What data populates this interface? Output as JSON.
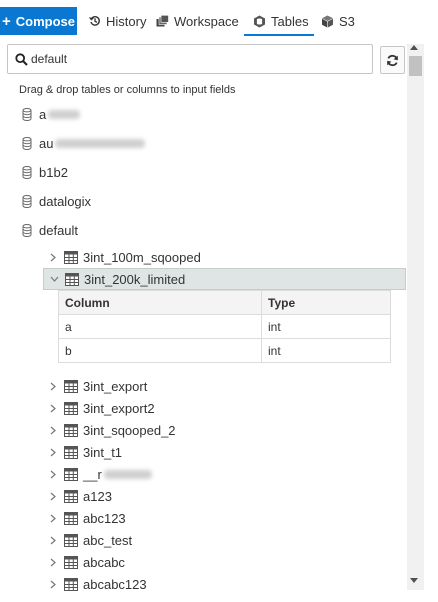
{
  "tabs": {
    "compose_label": "Compose",
    "history_label": "History",
    "workspace_label": "Workspace",
    "tables_label": "Tables",
    "s3_label": "S3",
    "active": "Tables"
  },
  "search": {
    "value": "default",
    "placeholder": "Search"
  },
  "hint": "Drag & drop tables or columns to input fields",
  "databases": [
    {
      "label": "a",
      "blurred": true
    },
    {
      "label": "au",
      "blurred": true
    },
    {
      "label": "b1b2",
      "blurred": false
    },
    {
      "label": "datalogix",
      "blurred": false
    },
    {
      "label": "default",
      "blurred": false
    }
  ],
  "tables_before": [
    {
      "label": "3int_100m_sqooped"
    }
  ],
  "expanded_table": {
    "label": "3int_200k_limited",
    "columns_header": "Column",
    "type_header": "Type",
    "columns": [
      {
        "name": "a",
        "type": "int"
      },
      {
        "name": "b",
        "type": "int"
      }
    ]
  },
  "tables_after": [
    {
      "label": "3int_export"
    },
    {
      "label": "3int_export2"
    },
    {
      "label": "3int_sqooped_2"
    },
    {
      "label": "3int_t1"
    },
    {
      "label": "__r",
      "blurred": true
    },
    {
      "label": "a123"
    },
    {
      "label": "abc123"
    },
    {
      "label": "abc_test"
    },
    {
      "label": "abcabc"
    },
    {
      "label": "abcabc123"
    }
  ],
  "colors": {
    "accent": "#0a78d1",
    "selected_row": "#dfe5e5"
  }
}
